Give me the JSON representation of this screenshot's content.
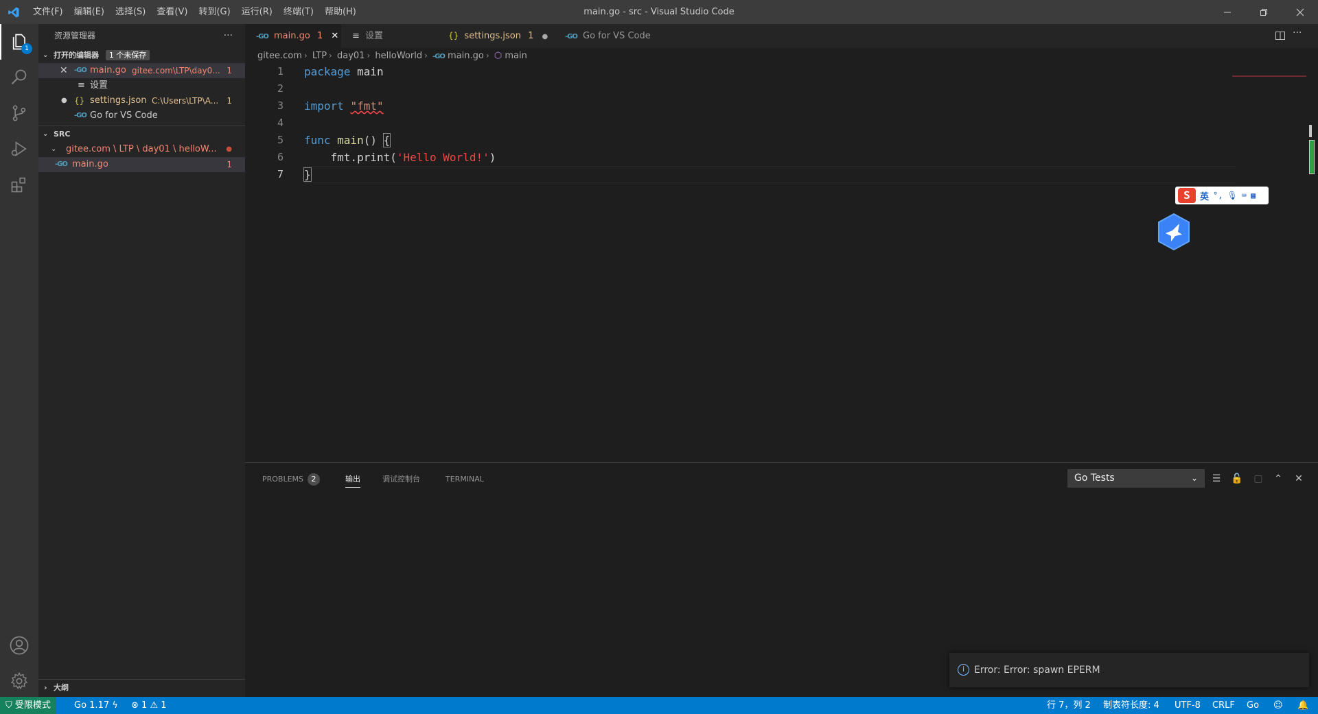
{
  "window": {
    "title": "main.go - src - Visual Studio Code",
    "menus": [
      "文件(F)",
      "编辑(E)",
      "选择(S)",
      "查看(V)",
      "转到(G)",
      "运行(R)",
      "终端(T)",
      "帮助(H)"
    ]
  },
  "activity": {
    "explorer_badge": "1"
  },
  "sidebar": {
    "title": "资源管理器",
    "more": "···",
    "open_editors": {
      "label": "打开的编辑器",
      "unsaved_badge": "1 个未保存",
      "items": [
        {
          "name": "main.go",
          "path": "gitee.com\\LTP\\day0...",
          "count": "1"
        },
        {
          "name": "设置"
        },
        {
          "name": "settings.json",
          "path": "C:\\Users\\LTP\\A...",
          "count": "1"
        },
        {
          "name": "Go for VS Code"
        }
      ]
    },
    "src": {
      "label": "SRC",
      "folder": "gitee.com \\ LTP \\ day01 \\ helloW...",
      "file": "main.go",
      "file_count": "1"
    },
    "outline": "大纲"
  },
  "tabs": [
    {
      "name": "main.go",
      "count": "1"
    },
    {
      "name": "设置"
    },
    {
      "name": "settings.json",
      "count": "1"
    },
    {
      "name": "Go for VS Code"
    }
  ],
  "breadcrumb": [
    "gitee.com",
    "LTP",
    "day01",
    "helloWorld",
    "main.go",
    "main"
  ],
  "code": {
    "line_numbers": [
      "1",
      "2",
      "3",
      "4",
      "5",
      "6",
      "7"
    ],
    "l1_kw": "package",
    "l1_rest": " main",
    "l3_kw": "import",
    "l3_str": "\"fmt\"",
    "l5_kw": "func",
    "l5_fn": " main",
    "l5_rest": "() ",
    "l5_brace": "{",
    "l6_pre": "    fmt.print(",
    "l6_str": "'Hello World!'",
    "l6_post": ")",
    "l7": "}"
  },
  "ime": {
    "lang": "英"
  },
  "panel": {
    "tabs": {
      "problems": "PROBLEMS",
      "problems_count": "2",
      "output": "输出",
      "debug": "调试控制台",
      "terminal": "TERMINAL"
    },
    "selected_channel": "Go Tests"
  },
  "notification": {
    "message": "Error: Error: spawn EPERM"
  },
  "statusbar": {
    "restricted": "受限模式",
    "go_version": "Go 1.17",
    "errors": "1",
    "warnings": "1",
    "position": "行 7，列 2",
    "tab_size": "制表符长度: 4",
    "encoding": "UTF-8",
    "eol": "CRLF",
    "language": "Go"
  },
  "colors": {
    "accent": "#007acc",
    "error": "#f48771",
    "modified": "#e2c08d"
  }
}
